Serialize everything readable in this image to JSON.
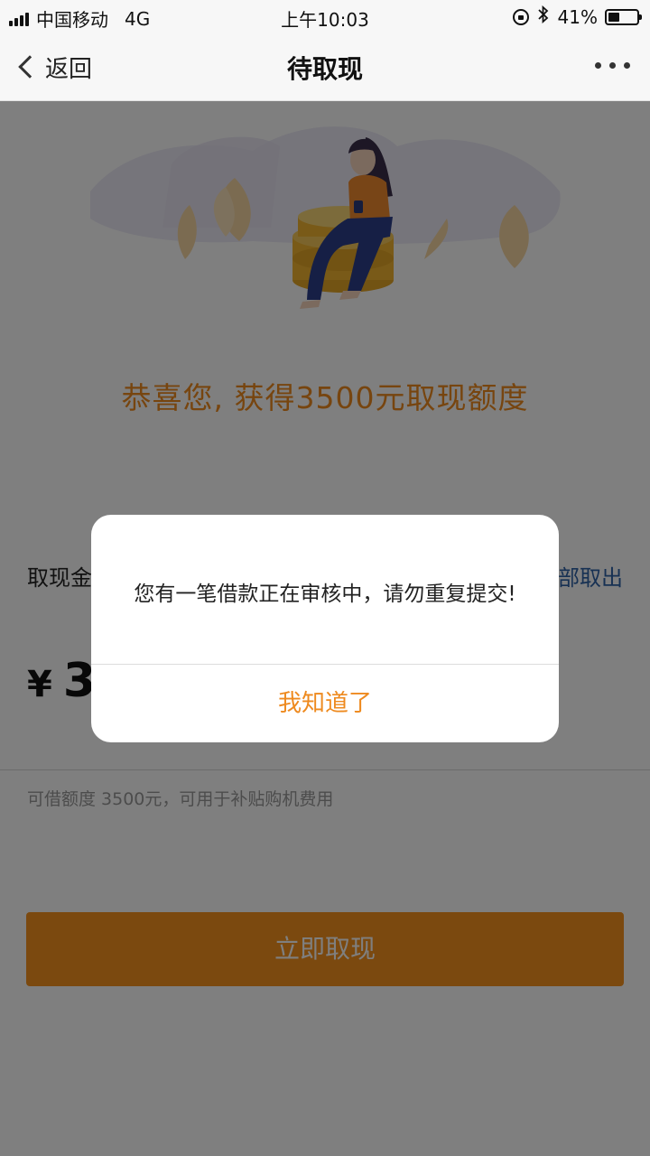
{
  "status_bar": {
    "carrier": "中国移动",
    "network": "4G",
    "time": "上午10:03",
    "battery_percent_text": "41%",
    "battery_level": 0.41
  },
  "nav": {
    "back_label": "返回",
    "title": "待取现"
  },
  "main": {
    "congrats": "恭喜您, 获得3500元取现额度",
    "amount_label": "取现金额",
    "withdraw_all": "全部取出",
    "currency": "¥",
    "amount_value": "3500",
    "hint": "可借额度 3500元，可用于补贴购机费用",
    "submit_label": "立即取现"
  },
  "modal": {
    "message": "您有一笔借款正在审核中，请勿重复提交!",
    "confirm_label": "我知道了"
  },
  "colors": {
    "accent": "#f7921e",
    "accent_text": "#ee8a1f",
    "link": "#2f62a7"
  },
  "icons": [
    "signal-icon",
    "lock-rotation-icon",
    "bluetooth-icon",
    "battery-icon",
    "chevron-left-icon",
    "more-dots-icon"
  ]
}
